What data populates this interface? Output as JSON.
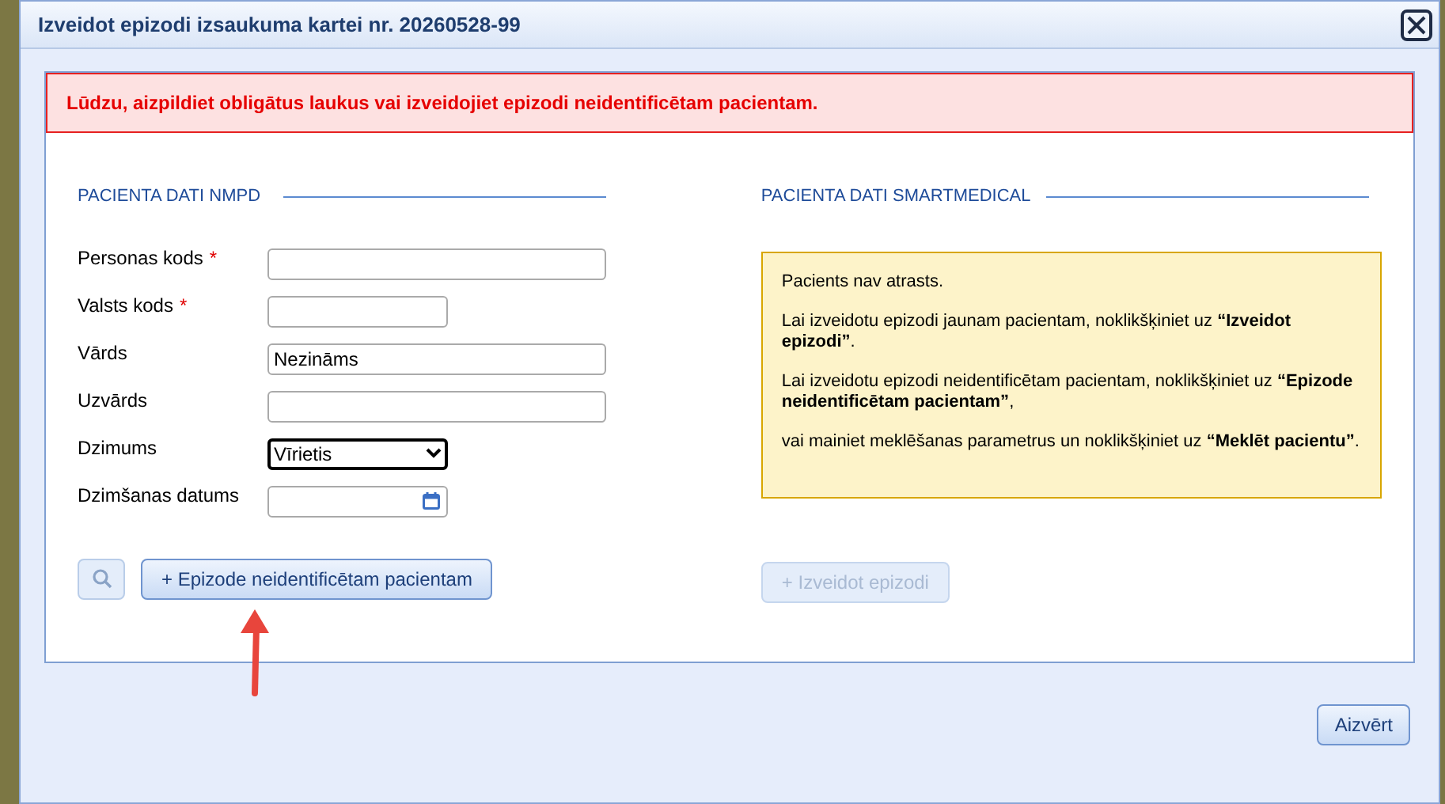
{
  "dialog": {
    "title": "Izveidot epizodi izsaukuma kartei nr. 20260528-99"
  },
  "error": "Lūdzu, aizpildiet obligātus laukus vai izveidojiet epizodi neidentificētam pacientam.",
  "left": {
    "heading": "PACIENTA DATI NMPD",
    "fields": [
      {
        "label": "Personas kods",
        "required": true,
        "kind": "text"
      },
      {
        "label": "Valsts kods",
        "required": true,
        "kind": "code"
      },
      {
        "label": "Vārds",
        "required": false,
        "kind": "text",
        "value": "Nezināms"
      },
      {
        "label": "Uzvārds",
        "required": false,
        "kind": "text"
      },
      {
        "label": "Dzimums",
        "required": false,
        "kind": "select",
        "value": "Vīrietis"
      },
      {
        "label": "Dzimšanas datums",
        "required": false,
        "kind": "date"
      }
    ],
    "required_mark": "*",
    "unidentified_button": {
      "label": "+ Epizode neidentificētam pacientam",
      "disabled": false
    }
  },
  "right": {
    "heading": "PACIENTA DATI SMARTMEDICAL",
    "info": [
      "Pacients nav atrasts.",
      "Lai izveidotu epizodi jaunam pacientam, noklikšķiniet uz **“Izveidot epizodi”**.",
      "Lai izveidotu epizodi neidentificētam pacientam, noklikšķiniet uz **“Epizode neidentificētam pacientam”**,",
      "vai mainiet meklēšanas parametrus un noklikšķiniet uz **“Meklēt pacientu”**."
    ],
    "create_button": {
      "label": "+ Izveidot epizodi",
      "disabled": true
    }
  },
  "close_button": "Aizvērt"
}
